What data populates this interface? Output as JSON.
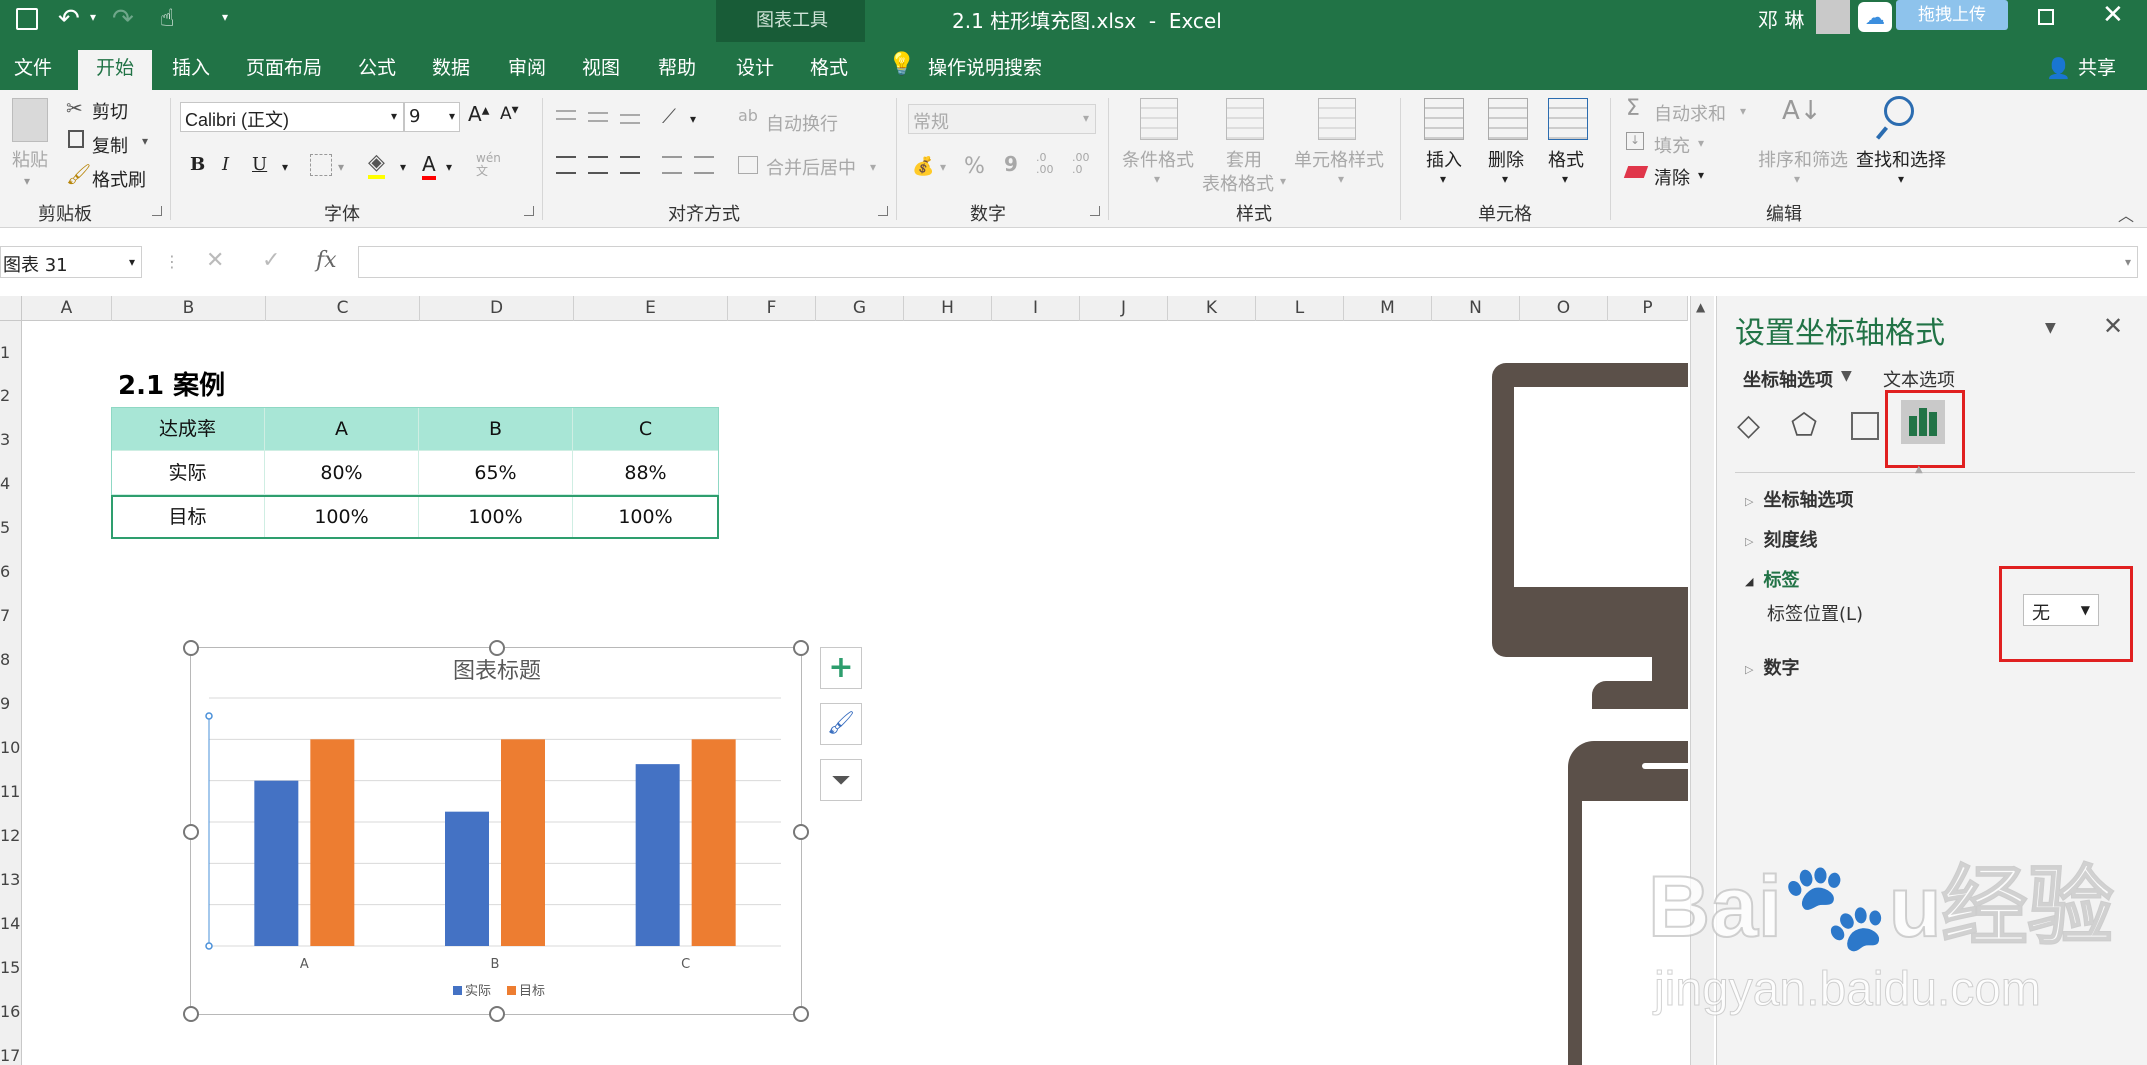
{
  "titlebar": {
    "context_tool": "图表工具",
    "doc_title": "2.1 柱形填充图.xlsx  -  Excel",
    "user": "邓 琳",
    "upload_label": "拖拽上传"
  },
  "tabs": [
    {
      "label": "文件"
    },
    {
      "label": "开始"
    },
    {
      "label": "插入"
    },
    {
      "label": "页面布局"
    },
    {
      "label": "公式"
    },
    {
      "label": "数据"
    },
    {
      "label": "审阅"
    },
    {
      "label": "视图"
    },
    {
      "label": "帮助"
    },
    {
      "label": "设计"
    },
    {
      "label": "格式"
    },
    {
      "label": "操作说明搜索"
    },
    {
      "label": "共享"
    }
  ],
  "ribbon": {
    "clipboard": {
      "paste": "粘贴",
      "cut": "剪切",
      "copy": "复制",
      "format_painter": "格式刷",
      "group": "剪贴板"
    },
    "font": {
      "font_name": "Calibri (正文)",
      "font_size": "9",
      "group": "字体",
      "bold": "B",
      "italic": "I",
      "underline": "U",
      "phonetic": "wén 文"
    },
    "alignment": {
      "wrap": "自动换行",
      "merge": "合并后居中",
      "group": "对齐方式"
    },
    "number": {
      "format": "常规",
      "percent": "%",
      "comma": "9",
      "inc_dec": ".0 .00",
      "dec_dec": ".00 .0",
      "group": "数字"
    },
    "styles": {
      "conditional": "条件格式",
      "table_format_1": "套用",
      "table_format_2": "表格格式",
      "cell_styles": "单元格样式",
      "group": "样式"
    },
    "cells": {
      "insert": "插入",
      "delete": "删除",
      "format": "格式",
      "group": "单元格"
    },
    "editing": {
      "autosum": "自动求和",
      "fill": "填充",
      "clear": "清除",
      "sort": "排序和筛选",
      "find": "查找和选择",
      "group": "编辑"
    }
  },
  "formula_bar": {
    "name_box": "图表 31",
    "fx": "fx",
    "content": ""
  },
  "columns": [
    "A",
    "B",
    "C",
    "D",
    "E",
    "F",
    "G",
    "H",
    "I",
    "J",
    "K",
    "L",
    "M",
    "N",
    "O",
    "P"
  ],
  "rows": [
    "1",
    "2",
    "3",
    "4",
    "5",
    "6",
    "7",
    "8",
    "9",
    "10",
    "11",
    "12",
    "13",
    "14",
    "15",
    "16",
    "17"
  ],
  "sheet": {
    "heading": "2.1 案例",
    "table_header": [
      "达成率",
      "A",
      "B",
      "C"
    ],
    "table_rows": [
      [
        "实际",
        "80%",
        "65%",
        "88%"
      ],
      [
        "目标",
        "100%",
        "100%",
        "100%"
      ]
    ]
  },
  "chart_data": {
    "type": "bar",
    "title": "图表标题",
    "categories": [
      "A",
      "B",
      "C"
    ],
    "series": [
      {
        "name": "实际",
        "values": [
          0.8,
          0.65,
          0.88
        ],
        "color": "#4472c4"
      },
      {
        "name": "目标",
        "values": [
          1.0,
          1.0,
          1.0
        ],
        "color": "#ed7d31"
      }
    ],
    "ylim": [
      0,
      1.2
    ],
    "grid": true,
    "legend": "bottom"
  },
  "colors": {
    "excel_green": "#217346",
    "accent_blue": "#4472c4",
    "accent_orange": "#ed7d31",
    "table_header_bg": "#a8e6d6",
    "annotation_red": "#e02020",
    "background_device": "#5b5049"
  },
  "pane": {
    "title": "设置坐标轴格式",
    "tab_axis": "坐标轴选项",
    "tab_text": "文本选项",
    "sections": [
      "坐标轴选项",
      "刻度线",
      "标签",
      "数字"
    ],
    "label_position_label": "标签位置(L)",
    "label_position_value": "无"
  },
  "watermark": {
    "url": "jingyan.baidu.com"
  }
}
